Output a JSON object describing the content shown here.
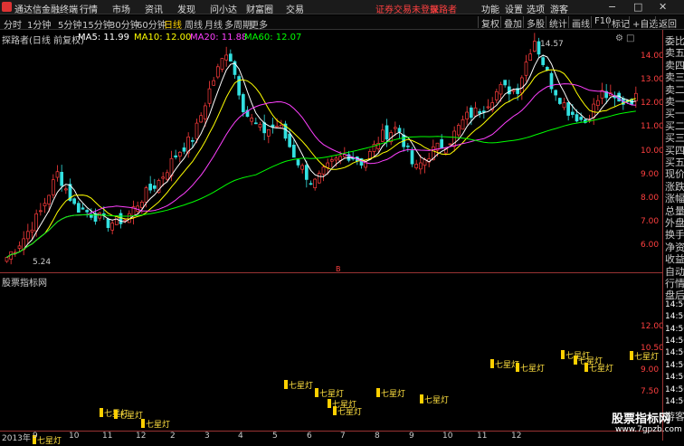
{
  "app": {
    "title": "通达信金融终端"
  },
  "menu": [
    "行情",
    "市场",
    "资讯",
    "发现",
    "问小达",
    "财富圈",
    "交易"
  ],
  "notice": "证券交易未登录",
  "stock_name_top": "探路者",
  "right_menu": [
    "功能",
    "设置",
    "选项",
    "游客"
  ],
  "periods": [
    "分时",
    "1分钟",
    "5分钟",
    "15分钟",
    "30分钟",
    "60分钟",
    "日线",
    "周线",
    "月线",
    "多周期",
    "更多"
  ],
  "active_period": "日线",
  "right_tools": [
    "复权",
    "叠加",
    "多股",
    "统计",
    "画线",
    "F10",
    "标记",
    "+自选",
    "返回"
  ],
  "chart_header": {
    "name": "探路者(日线 前复权)",
    "ma5": "MA5: 11.99",
    "ma10": "MA10: 12.00",
    "ma20": "MA20: 11.88",
    "ma60": "MA60: 12.07",
    "colors": {
      "ma5": "#ffffff",
      "ma10": "#ffff00",
      "ma20": "#ff40ff",
      "ma60": "#00ff00"
    }
  },
  "price_ticks": [
    "14.00",
    "13.00",
    "12.00",
    "11.00",
    "10.00",
    "9.00",
    "8.00",
    "7.00",
    "6.00"
  ],
  "price_marks": {
    "high": "14.57",
    "low": "5.24",
    "middle_mark": "B"
  },
  "side_panel": [
    "委比",
    "卖五",
    "卖四",
    "卖三",
    "卖二",
    "卖一",
    "买一",
    "买二",
    "买三",
    "买四",
    "买五",
    "现价",
    "涨跌",
    "涨幅",
    "总量",
    "外盘",
    "换手",
    "净资",
    "收益",
    "自动",
    "行情",
    "盘后",
    "14:50",
    "14:50",
    "14:50",
    "14:50",
    "14:50",
    "14:50",
    "14:50",
    "14:50",
    "14:50",
    "游客"
  ],
  "indicator": {
    "title": "股票指标网",
    "ticks": [
      "12.00",
      "10.50",
      "9.00",
      "7.50"
    ],
    "lamp_label": "七星灯"
  },
  "date_axis": [
    "2013年",
    "9",
    "10",
    "11",
    "12",
    "2",
    "3",
    "4",
    "5",
    "6",
    "7",
    "8",
    "9",
    "10",
    "11",
    "12"
  ],
  "watermark": {
    "text": "股票指标网",
    "url": "www.7gpzb.com"
  },
  "chart_data": {
    "type": "candlestick",
    "title": "探路者(日线 前复权)",
    "ylim": [
      5.0,
      14.6
    ],
    "approx_close_path": [
      5.4,
      6.2,
      7.3,
      8.9,
      7.5,
      7.2,
      6.8,
      7.0,
      7.9,
      8.6,
      9.7,
      10.4,
      12.5,
      14.1,
      11.4,
      10.6,
      10.9,
      9.5,
      8.4,
      9.2,
      9.7,
      9.3,
      10.4,
      10.8,
      9.0,
      9.8,
      10.2,
      11.2,
      11.6,
      12.4,
      12.3,
      14.5,
      12.6,
      11.5,
      11.0,
      12.2,
      11.8,
      12.0
    ],
    "high": 14.57,
    "low": 5.24
  }
}
